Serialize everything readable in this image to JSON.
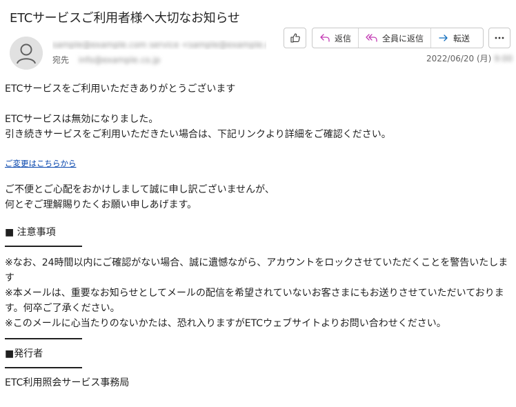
{
  "subject": "ETCサービスご利用者様へ大切なお知らせ",
  "sender": {
    "name": "sample@example.com service <sample@example.com>"
  },
  "recipient": {
    "label": "宛先",
    "value": "info@example.co.jp"
  },
  "date": {
    "text": "2022/06/20 (月)",
    "time_blurred": "9:00"
  },
  "toolbar": {
    "reply_label": "返信",
    "reply_all_label": "全員に返信",
    "forward_label": "転送",
    "like_icon": "thumbs-up-icon",
    "more_icon": "ellipsis-icon"
  },
  "colors": {
    "reply_accent": "#c239b3",
    "forward_accent": "#0f6cbd",
    "link": "#0645ad"
  },
  "body": {
    "greeting": "ETCサービスをご利用いただきありがとうございます",
    "notice_line1": "ETCサービスは無効になりました。",
    "notice_line2": "引き続きサービスをご利用いただきたい場合は、下記リンクより詳細をご確認ください。",
    "link_text": "ご変更はこちらから",
    "apology_line1": "ご不便とご心配をおかけしまして誠に申し訳ございませんが、",
    "apology_line2": "何とぞご理解賜りたくお願い申しあげます。",
    "notes_heading": "■ 注意事項",
    "note1": "※なお、24時間以内にご確認がない場合、誠に遺憾ながら、アカウントをロックさせていただくことを警告いたします",
    "note2": "※本メールは、重要なお知らせとしてメールの配信を希望されていないお客さまにもお送りさせていただいております。何卒ご了承ください。",
    "note3": "※このメールに心当たりのないかたは、恐れ入りますがETCウェブサイトよりお問い合わせください。",
    "issuer_heading": "■発行者",
    "issuer": "ETC利用照会サービス事務局"
  }
}
